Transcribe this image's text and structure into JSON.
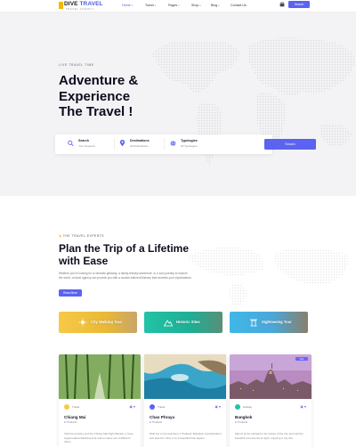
{
  "header": {
    "logo_main": "DIVE",
    "logo_accent": "TRAVEL",
    "logo_sub": "TRAVEL AGENCY",
    "nav": [
      {
        "label": "Home",
        "active": true,
        "has_caret": true
      },
      {
        "label": "Travel",
        "active": false,
        "has_caret": true
      },
      {
        "label": "Pages",
        "active": false,
        "has_caret": true
      },
      {
        "label": "Shop",
        "active": false,
        "has_caret": true
      },
      {
        "label": "Blog",
        "active": false,
        "has_caret": true
      },
      {
        "label": "Contact Us",
        "active": false,
        "has_caret": false
      }
    ],
    "cart_icon": "cart-icon",
    "cta_label": "Search"
  },
  "hero": {
    "kicker": "LIVE TRAVEL TIME",
    "title_line1": "Adventure &",
    "title_line2": "Experience",
    "title_line3": "The Travel !",
    "search": {
      "fields": [
        {
          "label": "Search",
          "value": "Your Keyword",
          "icon": "search-icon"
        },
        {
          "label": "Destinations",
          "value": "All Destinations",
          "icon": "location-pin-icon"
        },
        {
          "label": "Typologies",
          "value": "All Typologies",
          "icon": "globe-icon"
        }
      ],
      "button_label": "Search"
    }
  },
  "about": {
    "kicker": "THE TRAVEL EXPERTS",
    "title_line1": "Plan the Trip of a Lifetime",
    "title_line2": "with Ease",
    "text": "Whether you're looking for a romantic getaway, a family-friendly adventure, or a solo journey to explore the world, a travel agency can provide you with a custom-tailored itinerary that exceeds your expectations.",
    "button_label": "Read More",
    "categories": [
      {
        "label": "City Walking Tour",
        "icon": "sun-icon"
      },
      {
        "label": "Historic Sites",
        "icon": "mountain-icon"
      },
      {
        "label": "Sightseeing Tour",
        "icon": "temple-icon"
      }
    ],
    "cards": [
      {
        "title": "Chiang Mai",
        "location": "Thailand",
        "author": "Travel",
        "badge": "",
        "desc": "Visit the temples and the Chiang Mai Night Bazaar, a huge sugar-loaded Saturday-fruit and a unique set of different offers."
      },
      {
        "title": "Chao Phraya",
        "location": "Thailand",
        "author": "Travel",
        "badge": "",
        "desc": "Ride out to the beaches in Thailand, Bangkok, Kanchanaburi and Hua Hin. Dive in to a beautiful blue lagoon."
      },
      {
        "title": "Bangkok",
        "location": "Thailand",
        "author": "Holiday",
        "badge": "Tour",
        "desc": "Marvel at the cathedral, the culture of the city and visit the beautiful monuments at night, enjoying a city tour."
      }
    ]
  }
}
